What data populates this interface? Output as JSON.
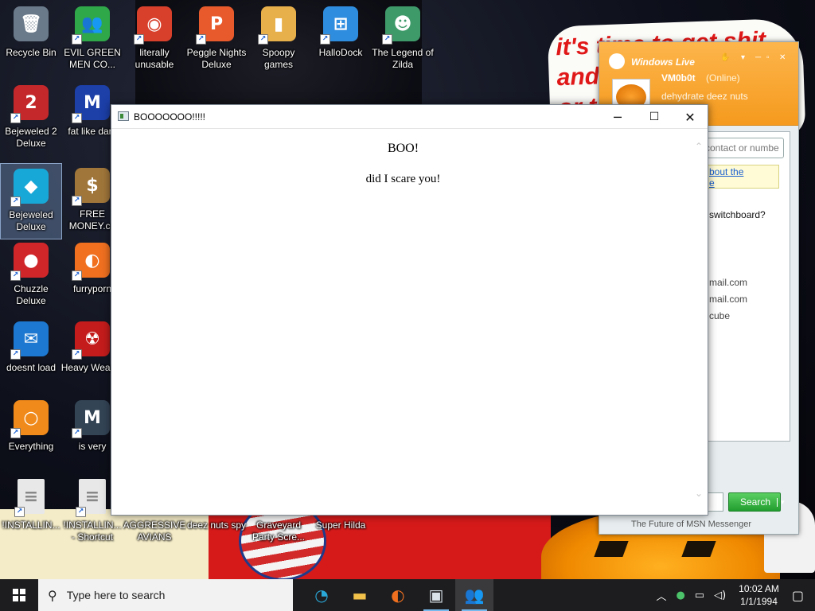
{
  "wallpaper": {
    "sign_text_line1": "it's time to get shit",
    "sign_text_line2": "and",
    "sign_text_line3": "or t"
  },
  "desktop": {
    "icons": [
      {
        "label": "Recycle Bin",
        "icon": "recycle-bin-icon",
        "glyph": "🗑",
        "color": "#6a7a8a"
      },
      {
        "label": "EVIL GREEN MEN CO...",
        "icon": "msn-buddies-icon",
        "glyph": "👥",
        "color": "#2fa84a"
      },
      {
        "label": "literally unusable",
        "icon": "chrome-icon",
        "glyph": "◉",
        "color": "#d8402c"
      },
      {
        "label": "Peggle Nights Deluxe",
        "icon": "peggle-icon",
        "glyph": "P",
        "color": "#e85a2b"
      },
      {
        "label": "Spoopy games",
        "icon": "folder-icon",
        "glyph": "▮",
        "color": "#e8b04a"
      },
      {
        "label": "HalloDock",
        "icon": "windows-logo-icon",
        "glyph": "⊞",
        "color": "#2f8de0"
      },
      {
        "label": "The Legend of Zilda",
        "icon": "zelda-character-icon",
        "glyph": "☻",
        "color": "#3f9a6a"
      },
      {
        "label": "Bejeweled 2 Deluxe",
        "icon": "bejeweled2-icon",
        "glyph": "2",
        "color": "#c4282a"
      },
      {
        "label": "fat like dark",
        "icon": "mpl-icon",
        "glyph": "M",
        "color": "#1c3fa8"
      },
      {
        "label": "Bejeweled Deluxe",
        "icon": "gem-icon",
        "glyph": "◆",
        "color": "#18a8d8"
      },
      {
        "label": "FREE MONEY.co",
        "icon": "money-bag-icon",
        "glyph": "$",
        "color": "#a0763a"
      },
      {
        "label": "Chuzzle Deluxe",
        "icon": "chuzzle-icon",
        "glyph": "●",
        "color": "#d0262a"
      },
      {
        "label": "furryporn",
        "icon": "firefox-icon",
        "glyph": "◐",
        "color": "#f07020"
      },
      {
        "label": "doesnt load",
        "icon": "thunderbird-icon",
        "glyph": "✉",
        "color": "#1c78d0"
      },
      {
        "label": "Heavy Weap...",
        "icon": "radiation-icon",
        "glyph": "☢",
        "color": "#c41c1c"
      },
      {
        "label": "Everything",
        "icon": "magnifier-icon",
        "glyph": "○",
        "color": "#f08a1a"
      },
      {
        "label": "is very",
        "icon": "mpl-shield-icon",
        "glyph": "M",
        "color": "#334455"
      },
      {
        "label": "!INSTALLIN...",
        "icon": "text-file-icon",
        "glyph": "≡",
        "color": "#e8e8e8"
      },
      {
        "label": "!INSTALLIN... - Shortcut",
        "icon": "text-file-icon",
        "glyph": "≡",
        "color": "#e8e8e8"
      },
      {
        "label": "AGGRESSIVE AVIANS",
        "icon": "game-icon",
        "glyph": "",
        "color": "transparent"
      },
      {
        "label": "deez nuts spy",
        "icon": "game-icon",
        "glyph": "",
        "color": "transparent"
      },
      {
        "label": "Graveyard Party Scre...",
        "icon": "game-icon",
        "glyph": "",
        "color": "transparent"
      },
      {
        "label": "Super Hilda",
        "icon": "game-icon",
        "glyph": "",
        "color": "transparent"
      }
    ]
  },
  "msn": {
    "title": "Windows Live",
    "display_name": "VM0b0t",
    "status": "(Online)",
    "personal_message": "dehydrate deez nuts",
    "search_placeholder": "contact or numbe",
    "alert_line1": "bout the",
    "alert_line2": "e",
    "question": "switchboard?",
    "contacts": [
      "mail.com",
      "mail.com",
      "cube"
    ],
    "search_button": "Search",
    "footer": "The Future of MSN Messenger"
  },
  "boo_window": {
    "title": "BOOOOOOO!!!!!",
    "heading": "BOO!",
    "text": "did I scare you!",
    "minimize_glyph": "─",
    "maximize_glyph": "☐",
    "close_glyph": "✕"
  },
  "taskbar": {
    "search_placeholder": "Type here to search",
    "apps": [
      {
        "name": "edge-icon",
        "glyph": "◔",
        "color": "#2aa8d8"
      },
      {
        "name": "file-explorer-icon",
        "glyph": "▬",
        "color": "#f2c14a"
      },
      {
        "name": "firefox-icon",
        "glyph": "◐",
        "color": "#f07020"
      },
      {
        "name": "app-window-icon",
        "glyph": "▣",
        "color": "#d8e2e8"
      },
      {
        "name": "msn-buddies-icon",
        "glyph": "👥",
        "color": "#2fa84a"
      }
    ],
    "time": "10:02 AM",
    "date": "1/1/1994"
  }
}
